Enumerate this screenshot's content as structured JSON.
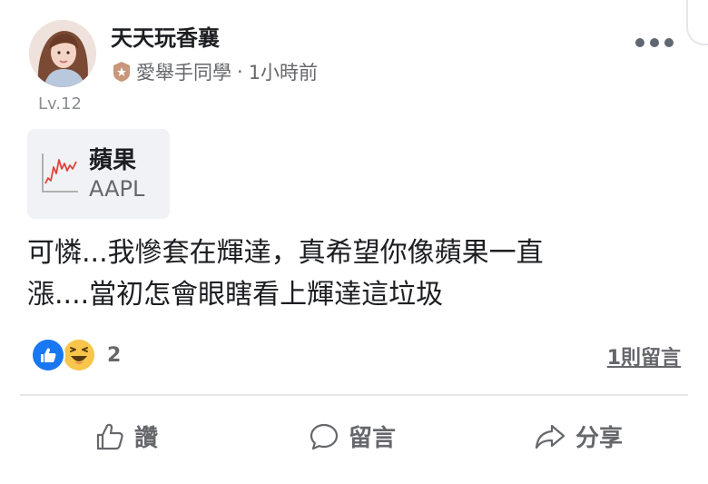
{
  "post": {
    "author": "天天玩香襄",
    "level": "Lv.12",
    "group": "愛舉手同學",
    "separator": "·",
    "time": "1小時前"
  },
  "stock": {
    "name": "蘋果",
    "ticker": "AAPL"
  },
  "content": {
    "line1": "可憐...我慘套在輝達，真希望你像蘋果一直",
    "line2": "漲....當初怎會眼瞎看上輝達這垃圾"
  },
  "reactions": {
    "count": "2",
    "icons": [
      "like-icon",
      "haha-icon"
    ],
    "like_color": "#1877f2",
    "haha_color": "#f7c64a"
  },
  "comments_link": "1則留言",
  "actions": {
    "like": "讚",
    "comment": "留言",
    "share": "分享"
  },
  "colors": {
    "text": "#1c1e21",
    "secondary": "#65676b",
    "badge": "#c8967a",
    "chart_line": "#e0433a"
  }
}
